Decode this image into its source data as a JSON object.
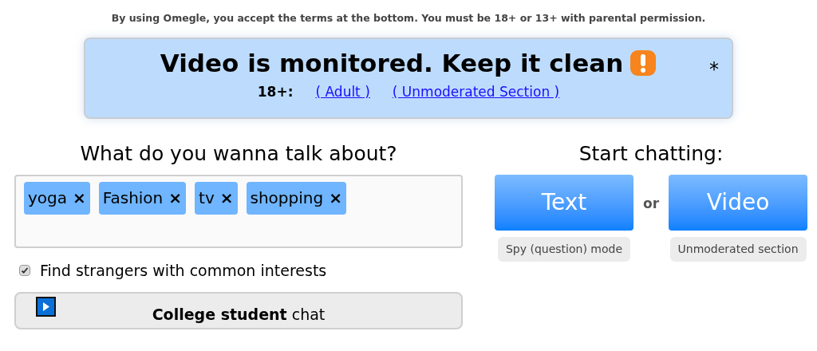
{
  "notice": "By using Omegle, you accept the terms at the bottom. You must be 18+ or 13+ with parental permission.",
  "banner": {
    "title": "Video is monitored. Keep it clean",
    "asterisk": "*",
    "age_label": "18+:",
    "links": [
      "( Adult )",
      "( Unmoderated Section )"
    ]
  },
  "interests": {
    "heading": "What do you wanna talk about?",
    "tags": [
      {
        "label": "yoga",
        "remove": "×"
      },
      {
        "label": "Fashion",
        "remove": "×"
      },
      {
        "label": "tv",
        "remove": "×"
      },
      {
        "label": "shopping",
        "remove": "×"
      }
    ],
    "common": {
      "label": "Find strangers with common interests",
      "checked": true
    },
    "college_button": "**College student** chat"
  },
  "start": {
    "heading": "Start chatting:",
    "or": "or",
    "buttons": [
      {
        "label": "Text",
        "sub": "Spy (question) mode"
      },
      {
        "label": "Video",
        "sub": "Unmoderated section"
      }
    ]
  }
}
